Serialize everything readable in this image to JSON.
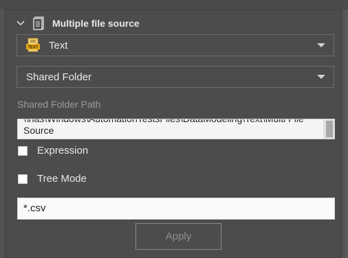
{
  "panel": {
    "title": "Multiple file source",
    "icons": {
      "collapse": "chevron-down-icon",
      "source": "document-icon",
      "type": "text-file-icon"
    }
  },
  "source_type": {
    "selected": "Text"
  },
  "location_type": {
    "selected": "Shared Folder"
  },
  "shared_folder": {
    "label": "Shared Folder Path",
    "value": "\\\\nas\\Windows\\AutomationTestsFiles\\DataModeling\\Text\\Multi File Source"
  },
  "options": {
    "expression_label": "Expression",
    "expression_checked": false,
    "tree_mode_label": "Tree Mode",
    "tree_mode_checked": false
  },
  "filter": {
    "value": "*.csv"
  },
  "actions": {
    "apply_label": "Apply"
  }
}
